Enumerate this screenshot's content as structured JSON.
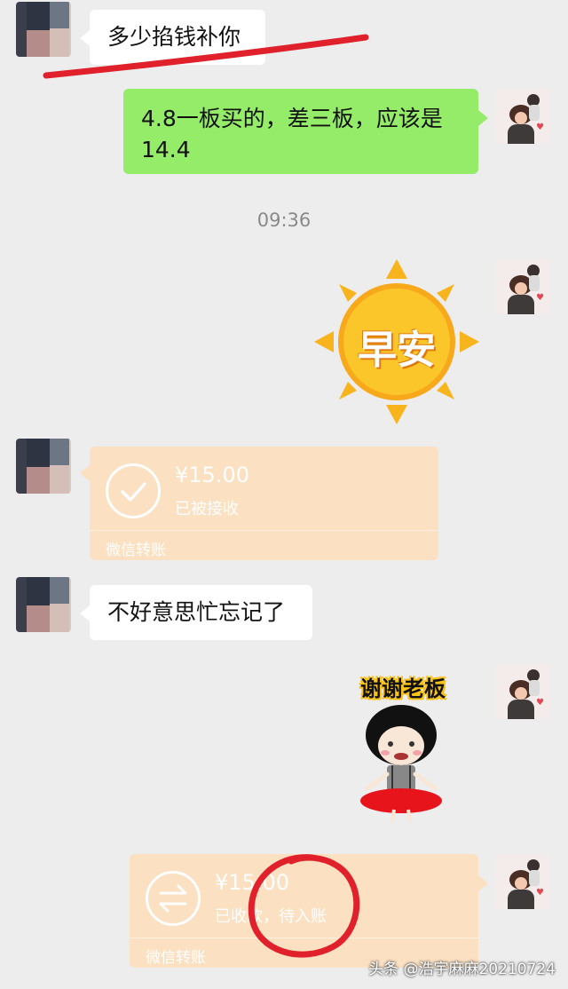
{
  "messages": {
    "m1": "多少掐钱补你",
    "m2": "4.8一板买的，差三板，应该是14.4",
    "m3": "不好意思忙忘记了"
  },
  "timestamp": "09:36",
  "stickers": {
    "sun_text": "早安",
    "boss_text": "谢谢老板"
  },
  "transfer_received": {
    "amount": "¥15.00",
    "status": "已被接收",
    "footer": "微信转账"
  },
  "transfer_pending": {
    "amount": "¥15.00",
    "status": "已收款，待入账",
    "footer": "微信转账"
  },
  "watermark": "头条 @浩宇麻麻20210724",
  "colors": {
    "green_bubble": "#95ec69",
    "transfer_orange": "#fbe0c1",
    "annotation_red": "#e0202a"
  }
}
